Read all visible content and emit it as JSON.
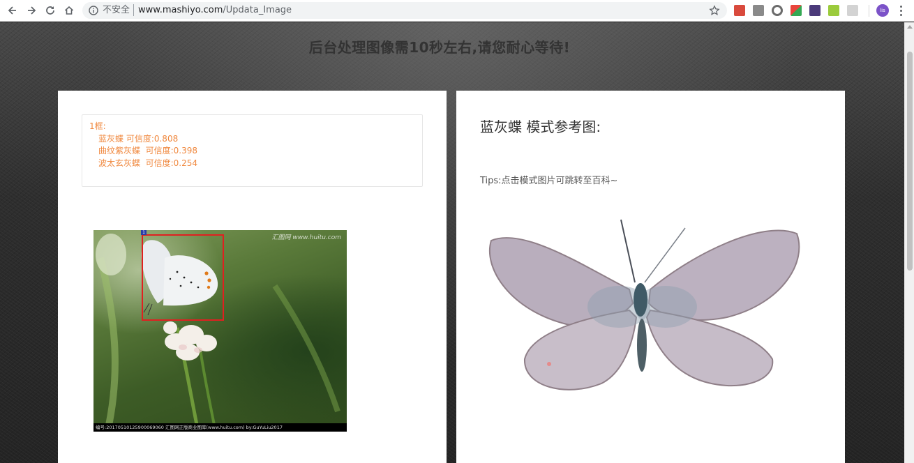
{
  "browser": {
    "security_label": "不安全",
    "url_host": "www.mashiyo.com",
    "url_path": "/Updata_Image",
    "avatar_initials": "lis"
  },
  "page": {
    "title": "后台处理图像需10秒左右,请您耐心等待!"
  },
  "results": {
    "box_label": "1框:",
    "items": [
      "蓝灰蝶 可信度:0.808",
      "曲纹紫灰蝶  可信度:0.398",
      "波太玄灰蝶  可信度:0.254"
    ],
    "color": "#f0883e"
  },
  "uploaded_image": {
    "watermark": "汇图网 www.huitu.com",
    "caption": "编号:20170510125900069060   汇图网正版商业图库(www.huitu.com) by:GuYuLiu2017",
    "bbox_tag": "1"
  },
  "reference": {
    "title": "蓝灰蝶 模式参考图:",
    "tips": "Tips:点击模式图片可跳转至百科~"
  }
}
